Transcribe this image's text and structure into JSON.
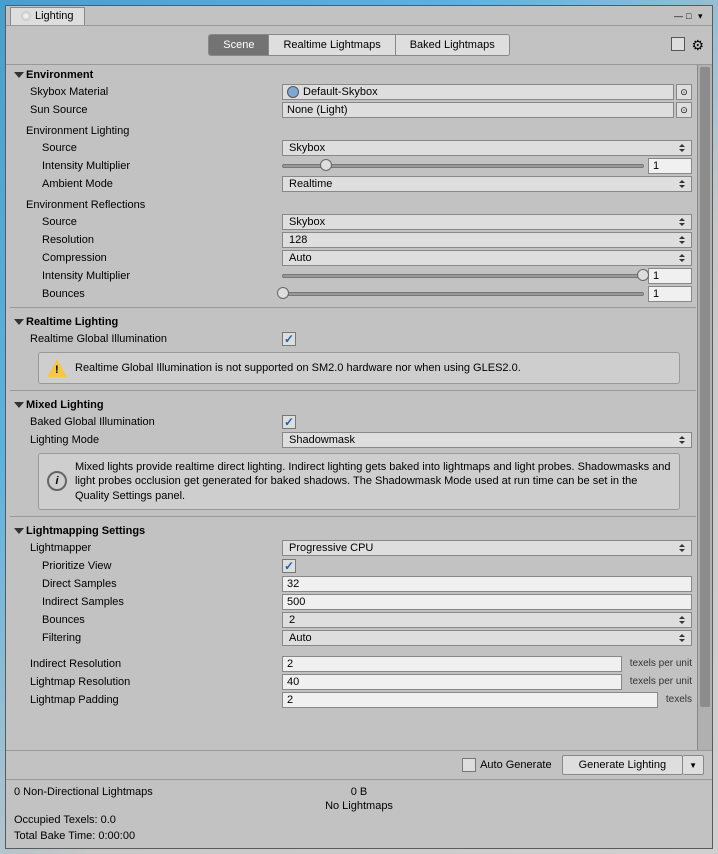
{
  "window": {
    "title": "Lighting"
  },
  "tabs": {
    "scene": "Scene",
    "realtime": "Realtime Lightmaps",
    "baked": "Baked Lightmaps"
  },
  "env": {
    "header": "Environment",
    "skybox_material": "Skybox Material",
    "skybox_value": "Default-Skybox",
    "sun_source": "Sun Source",
    "sun_value": "None (Light)",
    "lighting_header": "Environment Lighting",
    "source": "Source",
    "source_value": "Skybox",
    "intensity": "Intensity Multiplier",
    "intensity_value": "1",
    "ambient_mode": "Ambient Mode",
    "ambient_value": "Realtime",
    "refl_header": "Environment Reflections",
    "refl_source": "Source",
    "refl_source_value": "Skybox",
    "resolution": "Resolution",
    "resolution_value": "128",
    "compression": "Compression",
    "compression_value": "Auto",
    "refl_intensity": "Intensity Multiplier",
    "refl_intensity_value": "1",
    "bounces": "Bounces",
    "bounces_value": "1"
  },
  "realtime": {
    "header": "Realtime Lighting",
    "rgi": "Realtime Global Illumination",
    "warning": "Realtime Global Illumination is not supported on SM2.0 hardware nor when using GLES2.0."
  },
  "mixed": {
    "header": "Mixed Lighting",
    "bgi": "Baked Global Illumination",
    "mode": "Lighting Mode",
    "mode_value": "Shadowmask",
    "info": "Mixed lights provide realtime direct lighting. Indirect lighting gets baked into lightmaps and light probes. Shadowmasks and light probes occlusion get generated for baked shadows. The Shadowmask Mode used at run time can be set in the Quality Settings panel."
  },
  "lmap": {
    "header": "Lightmapping Settings",
    "lightmapper": "Lightmapper",
    "lightmapper_value": "Progressive CPU",
    "prioritize": "Prioritize View",
    "direct": "Direct Samples",
    "direct_value": "32",
    "indirect": "Indirect Samples",
    "indirect_value": "500",
    "bounces": "Bounces",
    "bounces_value": "2",
    "filtering": "Filtering",
    "filtering_value": "Auto",
    "indirect_res": "Indirect Resolution",
    "indirect_res_value": "2",
    "texels_unit": "texels per unit",
    "lightmap_res": "Lightmap Resolution",
    "lightmap_res_value": "40",
    "padding": "Lightmap Padding",
    "padding_value": "2",
    "texels": "texels"
  },
  "bottom": {
    "auto": "Auto Generate",
    "generate": "Generate Lighting"
  },
  "stats": {
    "lightmaps": "0 Non-Directional Lightmaps",
    "size": "0 B",
    "none": "No Lightmaps",
    "texels": "Occupied Texels: 0.0",
    "bake": "Total Bake Time: 0:00:00"
  }
}
